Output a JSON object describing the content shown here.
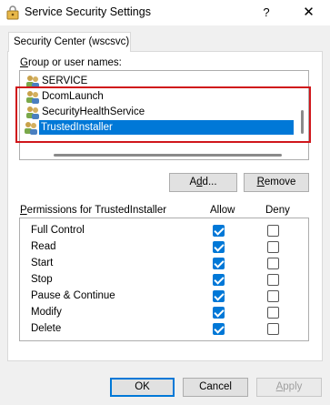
{
  "window": {
    "title": "Service Security Settings",
    "help_label": "?",
    "close_label": "✕"
  },
  "tab": {
    "label": "Security Center (wscsvc)"
  },
  "users": {
    "label_prefix": "G",
    "label_rest": "roup or user names:",
    "items": [
      {
        "label": "SERVICE",
        "selected": false
      },
      {
        "label": "DcomLaunch",
        "selected": false
      },
      {
        "label": "SecurityHealthService",
        "selected": false
      },
      {
        "label": "TrustedInstaller",
        "selected": true
      }
    ]
  },
  "buttons": {
    "add_u": "d",
    "add_pre": "A",
    "add_post": "d...",
    "remove_u": "R",
    "remove_rest": "emove",
    "ok": "OK",
    "cancel": "Cancel",
    "apply_u": "A",
    "apply_rest": "pply"
  },
  "permissions": {
    "label_u": "P",
    "label_rest": "ermissions for TrustedInstaller",
    "allow_header": "Allow",
    "deny_header": "Deny",
    "rows": [
      {
        "name": "Full Control",
        "allow": true,
        "deny": false
      },
      {
        "name": "Read",
        "allow": true,
        "deny": false
      },
      {
        "name": "Start",
        "allow": true,
        "deny": false
      },
      {
        "name": "Stop",
        "allow": true,
        "deny": false
      },
      {
        "name": "Pause & Continue",
        "allow": true,
        "deny": false
      },
      {
        "name": "Modify",
        "allow": true,
        "deny": false
      },
      {
        "name": "Delete",
        "allow": true,
        "deny": false
      }
    ]
  },
  "colors": {
    "selection": "#0078d7",
    "highlight_border": "#d0161b",
    "checkbox_checked": "#0078d7"
  }
}
